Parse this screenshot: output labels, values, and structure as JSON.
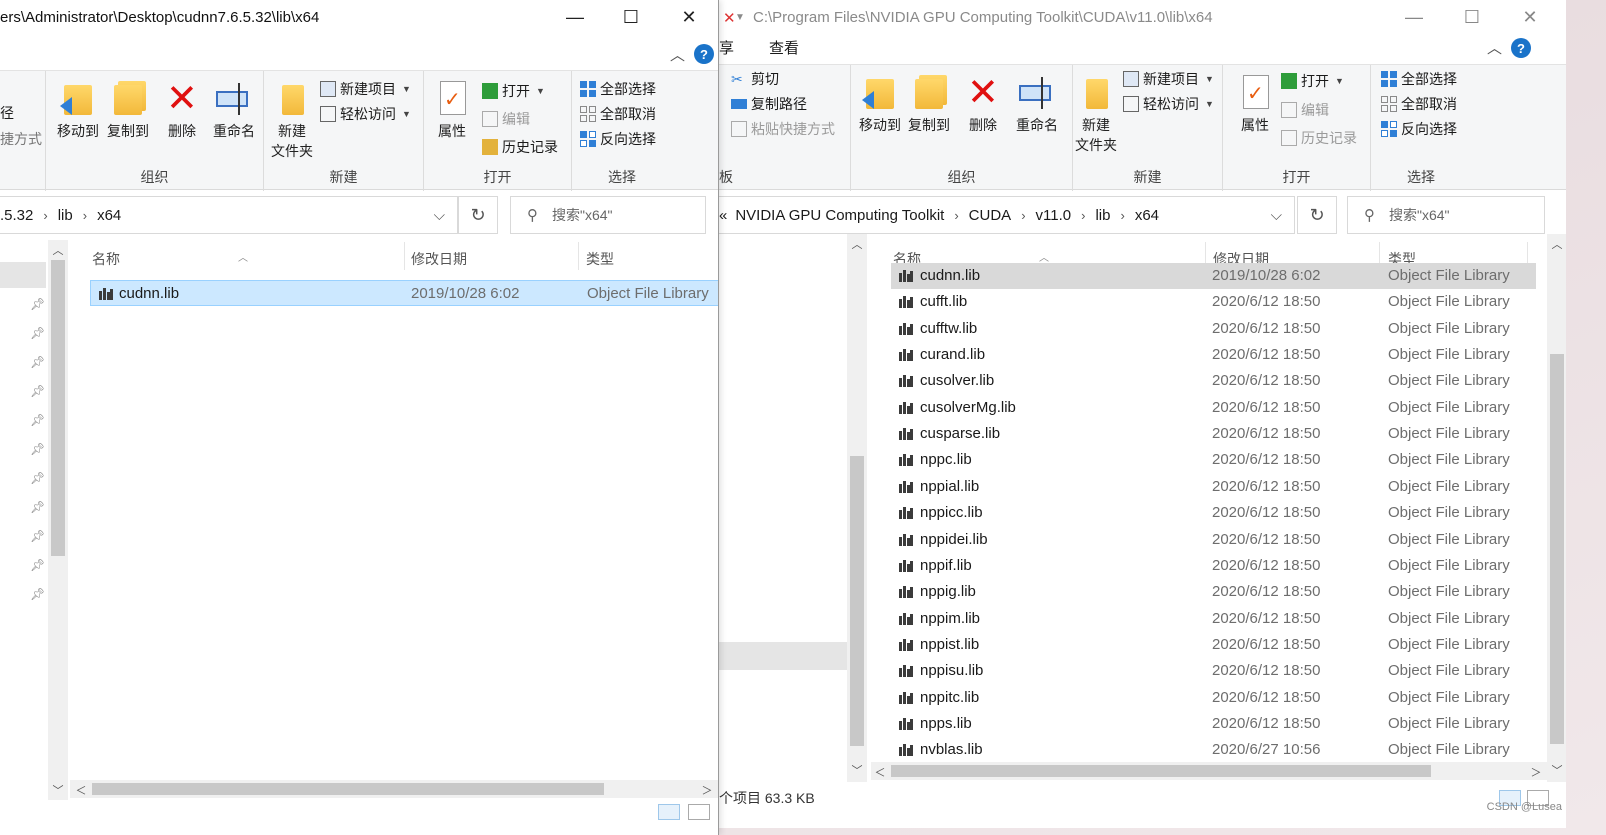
{
  "right": {
    "title": "C:\\Program Files\\NVIDIA GPU Computing Toolkit\\CUDA\\v11.0\\lib\\x64",
    "menu": {
      "tab_partial": "享",
      "view": "查看"
    },
    "clipboard": {
      "cut": "剪切",
      "copy_path": "复制路径",
      "paste_shortcut": "粘贴快捷方式",
      "group_partial": "板"
    },
    "organize": {
      "move_to": "移动到",
      "copy_to": "复制到",
      "delete": "删除",
      "rename": "重命名",
      "group": "组织"
    },
    "new": {
      "new_folder_1": "新建",
      "new_folder_2": "文件夹",
      "new_item": "新建项目",
      "easy_access": "轻松访问",
      "group": "新建"
    },
    "open": {
      "properties": "属性",
      "open": "打开",
      "edit": "编辑",
      "history": "历史记录",
      "group": "打开"
    },
    "select": {
      "select_all": "全部选择",
      "select_none": "全部取消",
      "invert": "反向选择",
      "group": "选择"
    },
    "breadcrumb": [
      "NVIDIA GPU Computing Toolkit",
      "CUDA",
      "v11.0",
      "lib",
      "x64"
    ],
    "breadcrumb_overflow": "«",
    "search_placeholder": "搜索\"x64\"",
    "columns": {
      "name": "名称",
      "date": "修改日期",
      "type": "类型"
    },
    "files": [
      {
        "name": "cudnn.lib",
        "date": "2019/10/28 6:02",
        "type": "Object File Library"
      },
      {
        "name": "cufft.lib",
        "date": "2020/6/12 18:50",
        "type": "Object File Library"
      },
      {
        "name": "cufftw.lib",
        "date": "2020/6/12 18:50",
        "type": "Object File Library"
      },
      {
        "name": "curand.lib",
        "date": "2020/6/12 18:50",
        "type": "Object File Library"
      },
      {
        "name": "cusolver.lib",
        "date": "2020/6/12 18:50",
        "type": "Object File Library"
      },
      {
        "name": "cusolverMg.lib",
        "date": "2020/6/12 18:50",
        "type": "Object File Library"
      },
      {
        "name": "cusparse.lib",
        "date": "2020/6/12 18:50",
        "type": "Object File Library"
      },
      {
        "name": "nppc.lib",
        "date": "2020/6/12 18:50",
        "type": "Object File Library"
      },
      {
        "name": "nppial.lib",
        "date": "2020/6/12 18:50",
        "type": "Object File Library"
      },
      {
        "name": "nppicc.lib",
        "date": "2020/6/12 18:50",
        "type": "Object File Library"
      },
      {
        "name": "nppidei.lib",
        "date": "2020/6/12 18:50",
        "type": "Object File Library"
      },
      {
        "name": "nppif.lib",
        "date": "2020/6/12 18:50",
        "type": "Object File Library"
      },
      {
        "name": "nppig.lib",
        "date": "2020/6/12 18:50",
        "type": "Object File Library"
      },
      {
        "name": "nppim.lib",
        "date": "2020/6/12 18:50",
        "type": "Object File Library"
      },
      {
        "name": "nppist.lib",
        "date": "2020/6/12 18:50",
        "type": "Object File Library"
      },
      {
        "name": "nppisu.lib",
        "date": "2020/6/12 18:50",
        "type": "Object File Library"
      },
      {
        "name": "nppitc.lib",
        "date": "2020/6/12 18:50",
        "type": "Object File Library"
      },
      {
        "name": "npps.lib",
        "date": "2020/6/12 18:50",
        "type": "Object File Library"
      },
      {
        "name": "nvblas.lib",
        "date": "2020/6/27 10:56",
        "type": "Object File Library"
      }
    ],
    "status": "个项目   63.3 KB"
  },
  "left": {
    "title": "ers\\Administrator\\Desktop\\cudnn7.6.5.32\\lib\\x64",
    "clipboard_partial_1": "径",
    "clipboard_partial_2": "捷方式",
    "organize": {
      "move_to": "移动到",
      "copy_to": "复制到",
      "delete": "删除",
      "rename": "重命名",
      "group": "组织"
    },
    "new": {
      "new_folder_1": "新建",
      "new_folder_2": "文件夹",
      "new_item": "新建项目",
      "easy_access": "轻松访问",
      "group": "新建"
    },
    "open": {
      "properties": "属性",
      "open": "打开",
      "edit": "编辑",
      "history": "历史记录",
      "group": "打开"
    },
    "select": {
      "select_all": "全部选择",
      "select_none": "全部取消",
      "invert": "反向选择",
      "group": "选择"
    },
    "breadcrumb": [
      ".5.32",
      "lib",
      "x64"
    ],
    "search_placeholder": "搜索\"x64\"",
    "columns": {
      "name": "名称",
      "date": "修改日期",
      "type": "类型"
    },
    "files": [
      {
        "name": "cudnn.lib",
        "date": "2019/10/28 6:02",
        "type": "Object File Library"
      }
    ]
  },
  "watermark": "CSDN @Lusea",
  "colors": {
    "selection": "#cce8ff",
    "selection_border": "#99d1ff",
    "hover_row": "#d9d9d9",
    "accent": "#1a73c9"
  }
}
